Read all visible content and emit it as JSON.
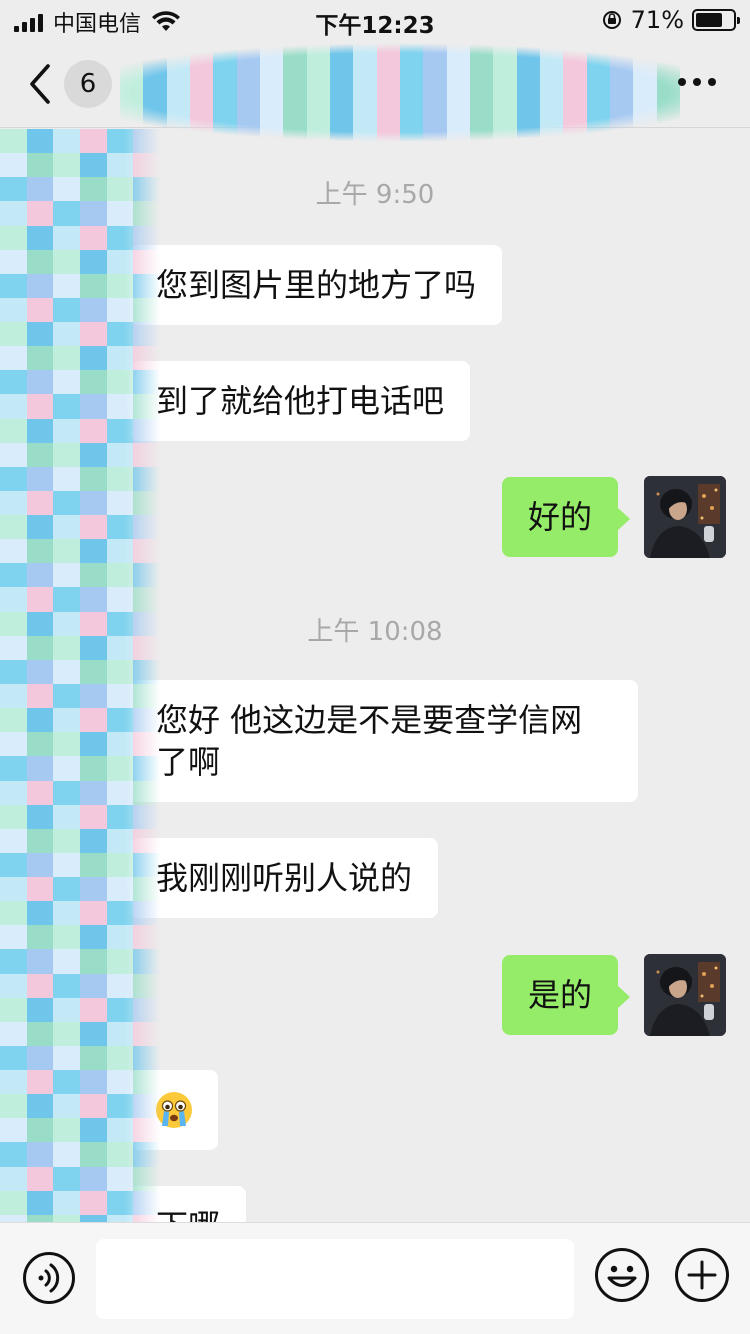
{
  "status_bar": {
    "carrier": "中国电信",
    "time": "下午12:23",
    "battery": "71%",
    "battery_level": 0.71
  },
  "nav": {
    "back_icon": "chevron-left-icon",
    "unread_count": "6",
    "more_icon": "more-dots-icon"
  },
  "messages": [
    {
      "type": "time",
      "text": "上午 9:50"
    },
    {
      "type": "in",
      "text": "您到图片里的地方了吗"
    },
    {
      "type": "in",
      "text": "到了就给他打电话吧"
    },
    {
      "type": "out",
      "text": "好的"
    },
    {
      "type": "time",
      "text": "上午 10:08"
    },
    {
      "type": "in",
      "lines": [
        "您好 他这边是不是要查学信网",
        "了啊"
      ]
    },
    {
      "type": "in",
      "text": "我刚刚听别人说的"
    },
    {
      "type": "out",
      "text": "是的"
    },
    {
      "type": "in",
      "emoji": "crying-emoji"
    },
    {
      "type": "in",
      "text": "下哪"
    }
  ],
  "input_bar": {
    "voice_icon": "voice-icon",
    "emoji_icon": "emoji-icon",
    "plus_icon": "plus-icon",
    "input_value": ""
  },
  "colors": {
    "background": "#ededed",
    "outgoing_bubble": "#95ec69",
    "incoming_bubble": "#ffffff",
    "time_label": "#a8a8a8"
  }
}
